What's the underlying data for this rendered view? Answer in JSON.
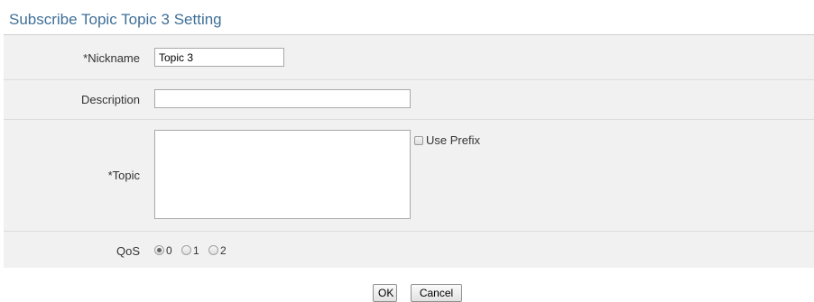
{
  "header": {
    "title": "Subscribe Topic Topic 3 Setting"
  },
  "form": {
    "nickname": {
      "label": "*Nickname",
      "value": "Topic 3"
    },
    "description": {
      "label": "Description",
      "value": ""
    },
    "topic": {
      "label": "*Topic",
      "value": "",
      "use_prefix_label": "Use Prefix",
      "use_prefix_checked": false
    },
    "qos": {
      "label": "QoS",
      "options": [
        "0",
        "1",
        "2"
      ],
      "selected": "0"
    }
  },
  "buttons": {
    "ok_label": "OK",
    "cancel_label": "Cancel"
  }
}
